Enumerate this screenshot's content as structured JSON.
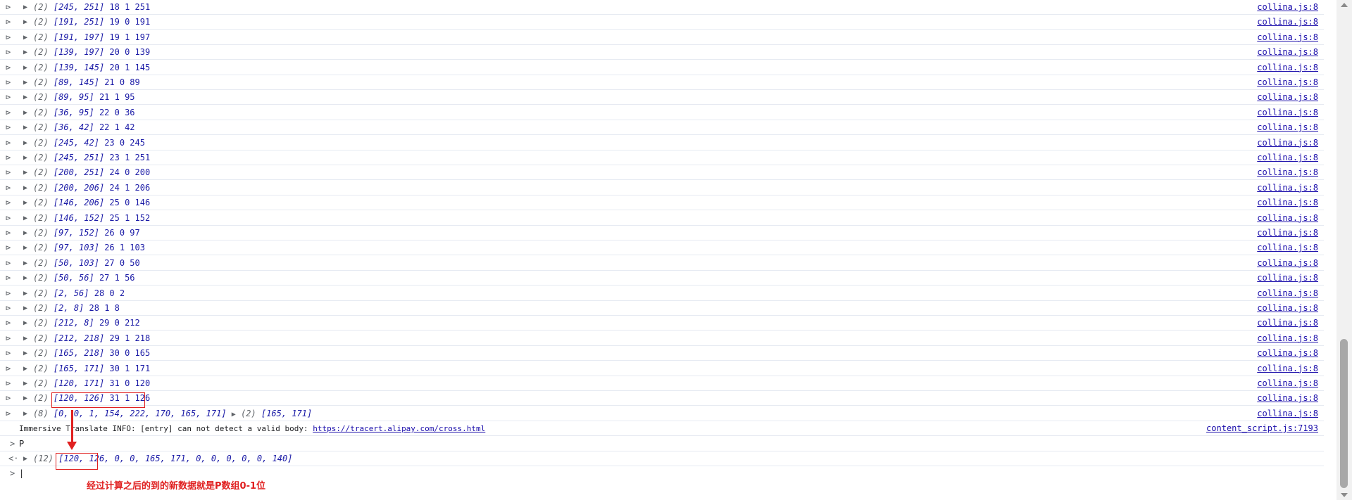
{
  "console": {
    "log_rows": [
      {
        "count": "(2)",
        "array": "[245, 251]",
        "values": "18 1 251",
        "source": "collina.js:8"
      },
      {
        "count": "(2)",
        "array": "[191, 251]",
        "values": "19 0 191",
        "source": "collina.js:8"
      },
      {
        "count": "(2)",
        "array": "[191, 197]",
        "values": "19 1 197",
        "source": "collina.js:8"
      },
      {
        "count": "(2)",
        "array": "[139, 197]",
        "values": "20 0 139",
        "source": "collina.js:8"
      },
      {
        "count": "(2)",
        "array": "[139, 145]",
        "values": "20 1 145",
        "source": "collina.js:8"
      },
      {
        "count": "(2)",
        "array": "[89, 145]",
        "values": "21 0 89",
        "source": "collina.js:8"
      },
      {
        "count": "(2)",
        "array": "[89, 95]",
        "values": "21 1 95",
        "source": "collina.js:8"
      },
      {
        "count": "(2)",
        "array": "[36, 95]",
        "values": "22 0 36",
        "source": "collina.js:8"
      },
      {
        "count": "(2)",
        "array": "[36, 42]",
        "values": "22 1 42",
        "source": "collina.js:8"
      },
      {
        "count": "(2)",
        "array": "[245, 42]",
        "values": "23 0 245",
        "source": "collina.js:8"
      },
      {
        "count": "(2)",
        "array": "[245, 251]",
        "values": "23 1 251",
        "source": "collina.js:8"
      },
      {
        "count": "(2)",
        "array": "[200, 251]",
        "values": "24 0 200",
        "source": "collina.js:8"
      },
      {
        "count": "(2)",
        "array": "[200, 206]",
        "values": "24 1 206",
        "source": "collina.js:8"
      },
      {
        "count": "(2)",
        "array": "[146, 206]",
        "values": "25 0 146",
        "source": "collina.js:8"
      },
      {
        "count": "(2)",
        "array": "[146, 152]",
        "values": "25 1 152",
        "source": "collina.js:8"
      },
      {
        "count": "(2)",
        "array": "[97, 152]",
        "values": "26 0 97",
        "source": "collina.js:8"
      },
      {
        "count": "(2)",
        "array": "[97, 103]",
        "values": "26 1 103",
        "source": "collina.js:8"
      },
      {
        "count": "(2)",
        "array": "[50, 103]",
        "values": "27 0 50",
        "source": "collina.js:8"
      },
      {
        "count": "(2)",
        "array": "[50, 56]",
        "values": "27 1 56",
        "source": "collina.js:8"
      },
      {
        "count": "(2)",
        "array": "[2, 56]",
        "values": "28 0 2",
        "source": "collina.js:8"
      },
      {
        "count": "(2)",
        "array": "[2, 8]",
        "values": "28 1 8",
        "source": "collina.js:8"
      },
      {
        "count": "(2)",
        "array": "[212, 8]",
        "values": "29 0 212",
        "source": "collina.js:8"
      },
      {
        "count": "(2)",
        "array": "[212, 218]",
        "values": "29 1 218",
        "source": "collina.js:8"
      },
      {
        "count": "(2)",
        "array": "[165, 218]",
        "values": "30 0 165",
        "source": "collina.js:8"
      },
      {
        "count": "(2)",
        "array": "[165, 171]",
        "values": "30 1 171",
        "source": "collina.js:8"
      },
      {
        "count": "(2)",
        "array": "[120, 171]",
        "values": "31 0 120",
        "source": "collina.js:8"
      },
      {
        "count": "(2)",
        "array": "[120, 126]",
        "values": "31 1 126",
        "source": "collina.js:8"
      }
    ],
    "last_log": {
      "count": "(8)",
      "array": "[0, 0, 1, 154, 222, 170, 165, 171]",
      "second_count": "(2)",
      "second_array": "[165, 171]",
      "source": "collina.js:8"
    },
    "info": {
      "text": "Immersive Translate INFO: [entry] can not detect a valid body:",
      "link": "https://tracert.alipay.com/cross.html",
      "source": "content_script.js:7193"
    },
    "input": {
      "prompt": ">",
      "text": "P"
    },
    "result": {
      "marker": "<·",
      "count": "(12)",
      "array": "[120, 126, 0, 0, 165, 171, 0, 0, 0, 0, 0, 140]"
    },
    "cursor_prompt": ">"
  },
  "annotation": {
    "text": "经过计算之后的到的新数据就是P数组0-1位",
    "color": "#e02020"
  }
}
